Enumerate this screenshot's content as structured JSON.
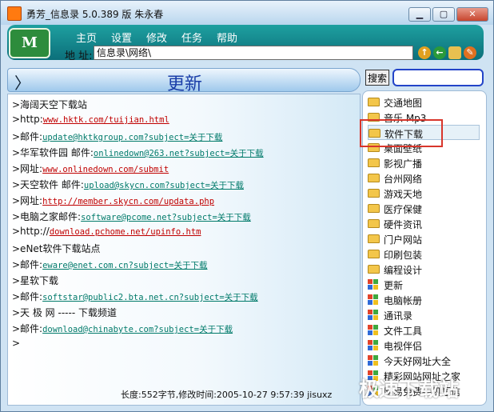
{
  "window": {
    "title": "勇芳_信息录  5.0.389 版  朱永春"
  },
  "menu": [
    "主页",
    "设置",
    "修改",
    "任务",
    "帮助"
  ],
  "address": {
    "label": "地 址:",
    "value": "信息录\\网络\\"
  },
  "header": {
    "chevron": "〉",
    "title": "更新"
  },
  "search": {
    "button_label": "搜索",
    "value": ""
  },
  "content_lines": [
    {
      "prefix": ">海阔天空下载站",
      "link": "",
      "link_color": ""
    },
    {
      "prefix": ">http:",
      "link": "www.hktk.com/tuijian.html",
      "link_color": "red"
    },
    {
      "prefix": ">邮件:",
      "link": "update@hktkgroup.com?subject=关于下载",
      "link_color": "teal"
    },
    {
      "prefix": ">华军软件园 邮件:",
      "link": "onlinedown@263.net?subject=关于下载",
      "link_color": "teal"
    },
    {
      "prefix": ">网址:",
      "link": "www.onlinedown.com/submit",
      "link_color": "red"
    },
    {
      "prefix": ">天空软件 邮件:",
      "link": "upload@skycn.com?subject=关于下载",
      "link_color": "teal"
    },
    {
      "prefix": ">网址:",
      "link": "http://member.skycn.com/updata.php",
      "link_color": "red"
    },
    {
      "prefix": ">电脑之家邮件:",
      "link": "software@pcome.net?subject=关于下载",
      "link_color": "teal"
    },
    {
      "prefix": ">http://",
      "link": "download.pchome.net/upinfo.htm",
      "link_color": "red"
    },
    {
      "prefix": ">eNet软件下载站点",
      "link": "",
      "link_color": ""
    },
    {
      "prefix": ">邮件:",
      "link": "eware@enet.com.cn?subject=关于下载",
      "link_color": "teal"
    },
    {
      "prefix": ">星软下载",
      "link": "",
      "link_color": ""
    },
    {
      "prefix": ">邮件:",
      "link": "softstar@public2.bta.net.cn?subject=关于下载",
      "link_color": "teal"
    },
    {
      "prefix": ">天   极   网 ----- 下载频道",
      "link": "",
      "link_color": ""
    },
    {
      "prefix": ">邮件:",
      "link": "download@chinabyte.com?subject=关于下载",
      "link_color": "teal"
    },
    {
      "prefix": ">",
      "link": "",
      "link_color": ""
    }
  ],
  "status": "长度:552字节,修改时间:2005-10-27  9:57:39 jisuxz",
  "sidebar": [
    {
      "label": "交通地图",
      "icon": "folder-icon"
    },
    {
      "label": "音乐 Mp3",
      "icon": "folder-icon"
    },
    {
      "label": "软件下载",
      "icon": "folder-icon",
      "selected": true
    },
    {
      "label": "桌面壁纸",
      "icon": "folder-icon"
    },
    {
      "label": "影视广播",
      "icon": "folder-icon"
    },
    {
      "label": "台州网络",
      "icon": "folder-icon"
    },
    {
      "label": "游戏天地",
      "icon": "folder-icon"
    },
    {
      "label": "医疗保健",
      "icon": "folder-icon"
    },
    {
      "label": "硬件资讯",
      "icon": "folder-icon"
    },
    {
      "label": "门户网站",
      "icon": "folder-icon"
    },
    {
      "label": "印刷包装",
      "icon": "folder-icon"
    },
    {
      "label": "编程设计",
      "icon": "folder-icon"
    },
    {
      "label": "更新",
      "icon": "windows-icon"
    },
    {
      "label": "电脑帐册",
      "icon": "windows-icon"
    },
    {
      "label": "通讯录",
      "icon": "windows-icon"
    },
    {
      "label": "文件工具",
      "icon": "windows-icon"
    },
    {
      "label": "电视伴侣",
      "icon": "windows-icon"
    },
    {
      "label": "今天好网址大全",
      "icon": "windows-icon"
    },
    {
      "label": "精彩网站网址之家",
      "icon": "windows-icon"
    },
    {
      "label": "网易免费手机短信",
      "icon": "windows-icon"
    }
  ],
  "watermark": "极速下载站",
  "colors": {
    "menu_bg": "#12898e",
    "header_title": "#1a3ea8",
    "link_red": "#c00000",
    "link_teal": "#007a6a",
    "highlight_box": "#d8362c"
  }
}
